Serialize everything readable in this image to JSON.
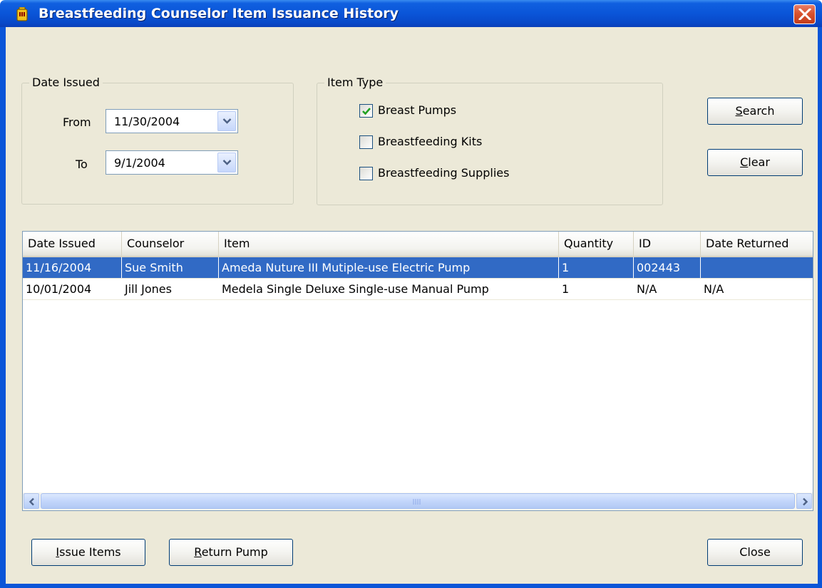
{
  "window": {
    "title": "Breastfeeding Counselor Item Issuance History"
  },
  "date_issued": {
    "legend": "Date Issued",
    "from_label": "From",
    "from_value": "11/30/2004",
    "to_label": "To",
    "to_value": "9/1/2004"
  },
  "item_type": {
    "legend": "Item Type",
    "options": [
      {
        "label": "Breast Pumps",
        "checked": true
      },
      {
        "label": "Breastfeeding Kits",
        "checked": false
      },
      {
        "label": "Breastfeeding Supplies",
        "checked": false
      }
    ]
  },
  "buttons": {
    "search": "Search",
    "clear": "Clear",
    "issue_items": "Issue Items",
    "return_pump": "Return Pump",
    "close": "Close"
  },
  "table": {
    "columns": [
      "Date Issued",
      "Counselor",
      "Item",
      "Quantity",
      "ID",
      "Date Returned"
    ],
    "rows": [
      {
        "date_issued": "11/16/2004",
        "counselor": "Sue Smith",
        "item": "Ameda Nuture III Mutiple-use Electric Pump",
        "quantity": "1",
        "id": "002443",
        "date_returned": "",
        "selected": true
      },
      {
        "date_issued": "10/01/2004",
        "counselor": "Jill Jones",
        "item": "Medela Single Deluxe Single-use Manual Pump",
        "quantity": "1",
        "id": "N/A",
        "date_returned": "N/A",
        "selected": false
      }
    ]
  },
  "colors": {
    "title_bar": "#0a55d8",
    "selection": "#316ac5",
    "dialog_bg": "#ece9d8"
  }
}
